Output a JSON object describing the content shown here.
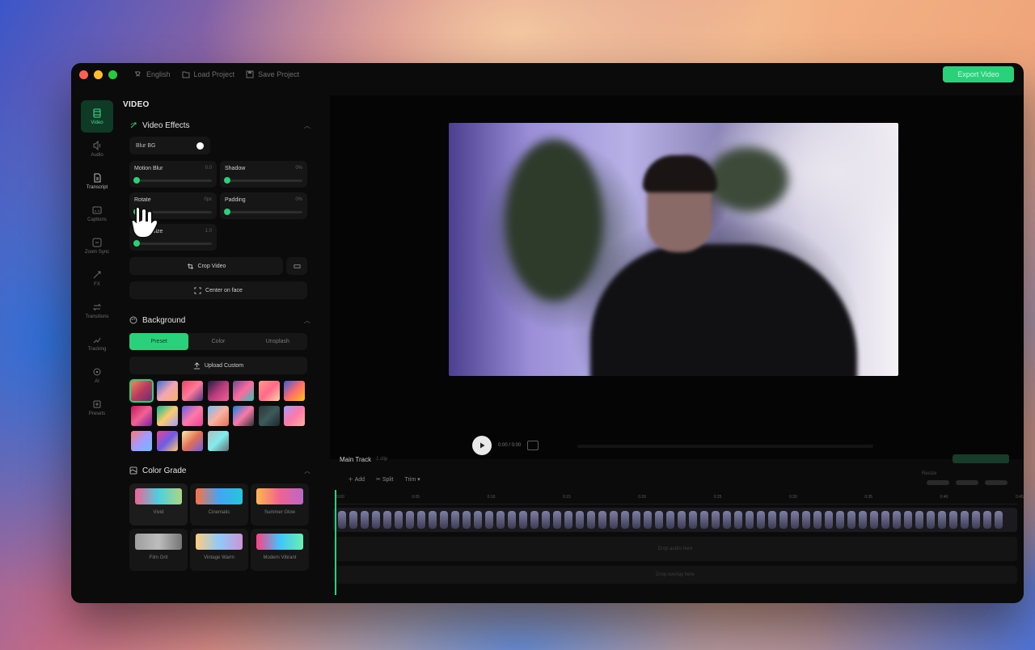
{
  "titlebar": {
    "language": "English",
    "load_project": "Load Project",
    "save_project": "Save Project",
    "export_label": "Export Video"
  },
  "rail": {
    "items": [
      {
        "label": "Video",
        "icon": "video-icon"
      },
      {
        "label": "Audio",
        "icon": "audio-icon"
      },
      {
        "label": "Transcript",
        "icon": "transcript-icon"
      },
      {
        "label": "Captions",
        "icon": "captions-icon"
      },
      {
        "label": "Zoom Sync",
        "icon": "zoom-icon"
      },
      {
        "label": "FX",
        "icon": "fx-icon"
      },
      {
        "label": "Transitions",
        "icon": "transitions-icon"
      },
      {
        "label": "Tracking",
        "icon": "tracking-icon"
      },
      {
        "label": "AI",
        "icon": "ai-icon"
      },
      {
        "label": "Presets",
        "icon": "presets-icon"
      }
    ]
  },
  "panel": {
    "title": "VIDEO",
    "effects": {
      "heading": "Video Effects",
      "blur_bg": "Blur BG",
      "sliders": [
        {
          "label": "Motion Blur",
          "value": "0.0",
          "level": 0
        },
        {
          "label": "Shadow",
          "value": "0%",
          "level": 0
        },
        {
          "label": "Rotate",
          "value": "0px",
          "level": 0
        },
        {
          "label": "Padding",
          "value": "0%",
          "level": 0
        },
        {
          "label": "Cursor size",
          "value": "1.0",
          "level": 0
        }
      ],
      "crop_label": "Crop Video",
      "center_label": "Center on face"
    },
    "background": {
      "heading": "Background",
      "tabs": [
        "Preset",
        "Color",
        "Unsplash"
      ],
      "active_tab": 0,
      "upload_label": "Upload Custom",
      "swatches": [
        "linear-gradient(135deg,#f08a5d,#b83b5e,#6a2c70)",
        "linear-gradient(135deg,#3a6bd8,#f2a6b3,#f7b267)",
        "linear-gradient(135deg,#e94560,#ff7a9a,#533483)",
        "linear-gradient(135deg,#1e1e3f,#b83b7e,#f06292)",
        "linear-gradient(135deg,#6a4c93,#ff6b9d,#2ec4b6)",
        "linear-gradient(135deg,#ff9a8b,#ff6a88,#ffd3a5)",
        "linear-gradient(135deg,#3b5bdb,#ff6b6b,#fcc419)",
        "linear-gradient(135deg,#c2185b,#f06292,#7b1fa2)",
        "linear-gradient(135deg,#00b894,#fdcb6e,#a29bfe)",
        "linear-gradient(135deg,#6c5ce7,#fd79a8,#e84393)",
        "linear-gradient(135deg,#74b9ff,#fab1a0,#e17055)",
        "linear-gradient(135deg,#0984e3,#fd79a8,#2d3436)",
        "linear-gradient(135deg,#2d3436,#3d5a5a,#1e272e)",
        "linear-gradient(135deg,#a29bfe,#fd79a8,#fab1a0)",
        "linear-gradient(135deg,#ff7675,#a29bfe,#74b9ff)",
        "linear-gradient(135deg,#e84393,#6c5ce7,#fdcb6e)",
        "linear-gradient(135deg,#ffeaa7,#e17055,#6c5ce7)",
        "linear-gradient(135deg,#b2bec3,#81ecec,#636e72)"
      ],
      "selected_swatch": 0
    },
    "grades": {
      "heading": "Color Grade",
      "items": [
        {
          "label": "Vivid",
          "gradient": "linear-gradient(90deg,#f06292,#4dd0e1,#aed581)"
        },
        {
          "label": "Cinematic",
          "gradient": "linear-gradient(90deg,#ff7043,#42a5f5,#26c6da)"
        },
        {
          "label": "Summer Glow",
          "gradient": "linear-gradient(90deg,#ffb74d,#f06292,#ba68c8)"
        },
        {
          "label": "Film Grit",
          "gradient": "linear-gradient(90deg,#9e9e9e,#bdbdbd,#757575)"
        },
        {
          "label": "Vintage Warm",
          "gradient": "linear-gradient(90deg,#ffcc80,#90caf9,#ce93d8)"
        },
        {
          "label": "Modern Vibrant",
          "gradient": "linear-gradient(90deg,#ff4081,#40c4ff,#69f0ae)"
        }
      ],
      "selected": 0
    }
  },
  "player": {
    "time": "0:00 / 0:00",
    "divider": "Resize"
  },
  "timeline": {
    "title": "Main Track",
    "subtitle": "1 clip",
    "tools": [
      "Add",
      "Split",
      "Trim"
    ],
    "ticks": [
      "0:00",
      "0:05",
      "0:10",
      "0:15",
      "0:20",
      "0:25",
      "0:30",
      "0:35",
      "0:40",
      "0:45"
    ],
    "empty_track": "Drop audio here",
    "empty_track2": "Drop overlay here",
    "playhead_label": "0:00"
  },
  "colors": {
    "accent": "#2bd17a",
    "window_bg": "#0b0b0c"
  }
}
